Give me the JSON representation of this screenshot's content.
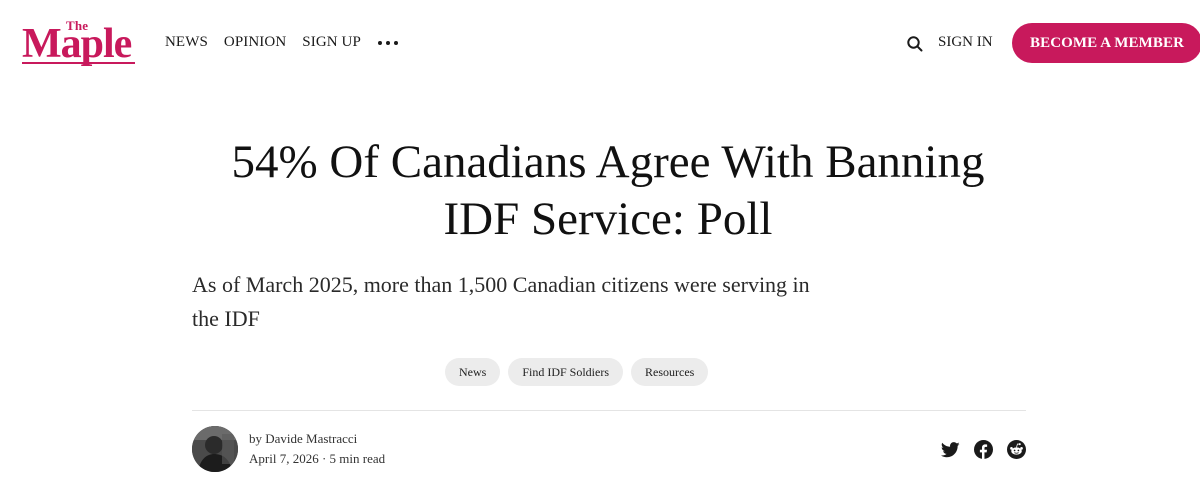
{
  "logo": {
    "small": "The",
    "main": "Maple"
  },
  "nav": {
    "items": [
      "NEWS",
      "OPINION",
      "SIGN UP"
    ]
  },
  "header": {
    "signin": "SIGN IN",
    "member_button": "BECOME A MEMBER"
  },
  "article": {
    "title": "54% Of Canadians Agree With Banning IDF Service: Poll",
    "subtitle": "As of March 2025, more than 1,500 Canadian citizens were serving in the IDF",
    "tags": [
      "News",
      "Find IDF Soldiers",
      "Resources"
    ],
    "author": "by Davide Mastracci",
    "date_read": "April 7, 2026 · 5 min read"
  },
  "share": {
    "icons": [
      "twitter-icon",
      "facebook-icon",
      "reddit-icon"
    ]
  },
  "colors": {
    "brand": "#c8195c",
    "tag_bg": "#ececec"
  }
}
